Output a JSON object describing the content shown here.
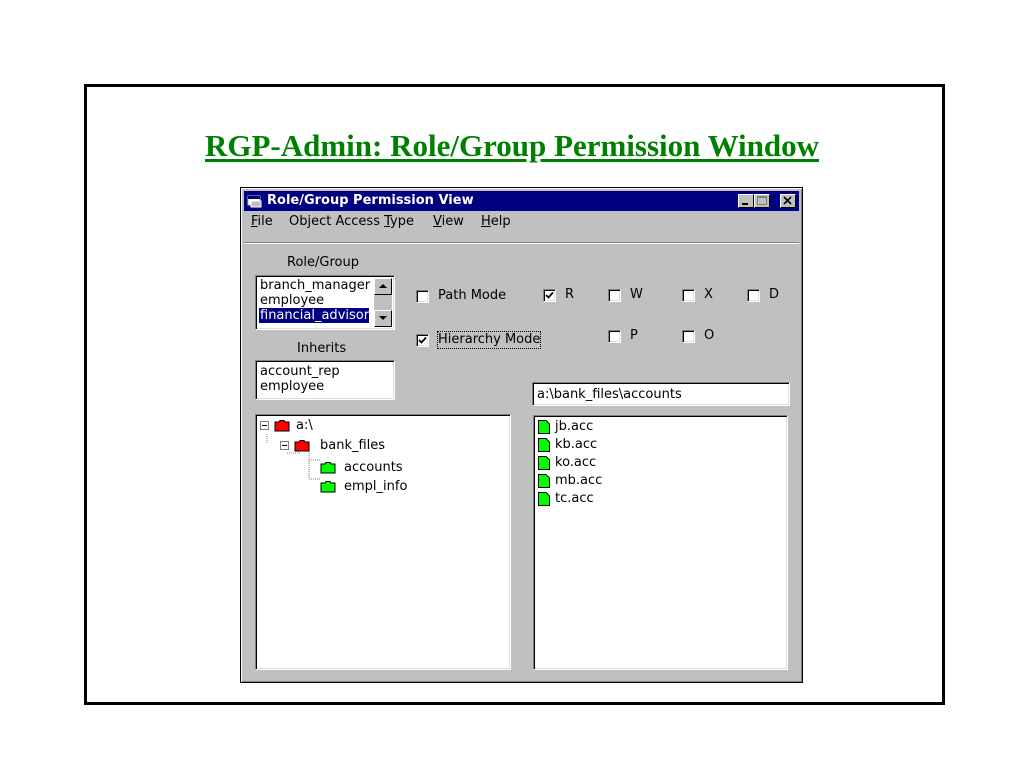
{
  "slide": {
    "title": "RGP-Admin: Role/Group Permission Window",
    "title_color": "#008000"
  },
  "window": {
    "title": "Role/Group Permission View",
    "titlebar_color": "#000080",
    "icon": "app-window-icon",
    "controls": [
      "minimize-icon",
      "maximize-icon",
      "close-icon"
    ]
  },
  "menu": {
    "items": [
      {
        "label": "File",
        "mnemonic": "F"
      },
      {
        "label": "Object Access Type",
        "mnemonic": "T"
      },
      {
        "label": "View",
        "mnemonic": "V"
      },
      {
        "label": "Help",
        "mnemonic": "H"
      }
    ]
  },
  "role_group": {
    "label": "Role/Group",
    "items": [
      "branch_manager",
      "employee",
      "financial_advisor"
    ],
    "selected_index": 2
  },
  "inherits": {
    "label": "Inherits",
    "items": [
      "account_rep",
      "employee"
    ]
  },
  "modes": {
    "path_mode": {
      "label": "Path Mode",
      "checked": false
    },
    "hierarchy_mode": {
      "label": "Hierarchy Mode",
      "checked": true
    }
  },
  "permissions": [
    {
      "label": "R",
      "checked": true
    },
    {
      "label": "W",
      "checked": false
    },
    {
      "label": "X",
      "checked": false
    },
    {
      "label": "D",
      "checked": false
    },
    {
      "label": "P",
      "checked": false
    },
    {
      "label": "O",
      "checked": false
    }
  ],
  "path": {
    "value": "a:\\bank_files\\accounts"
  },
  "tree": {
    "nodes": [
      {
        "label": "a:\\",
        "icon": "folder-icon",
        "color": "#ff0000",
        "expanded": true
      },
      {
        "label": "bank_files",
        "icon": "folder-icon",
        "color": "#ff0000",
        "expanded": true
      },
      {
        "label": "accounts",
        "icon": "folder-icon",
        "color": "#00ff00"
      },
      {
        "label": "empl_info",
        "icon": "folder-icon",
        "color": "#00ff00"
      }
    ]
  },
  "files": {
    "icon": "file-icon",
    "color": "#00ff00",
    "items": [
      "jb.acc",
      "kb.acc",
      "ko.acc",
      "mb.acc",
      "tc.acc"
    ]
  }
}
